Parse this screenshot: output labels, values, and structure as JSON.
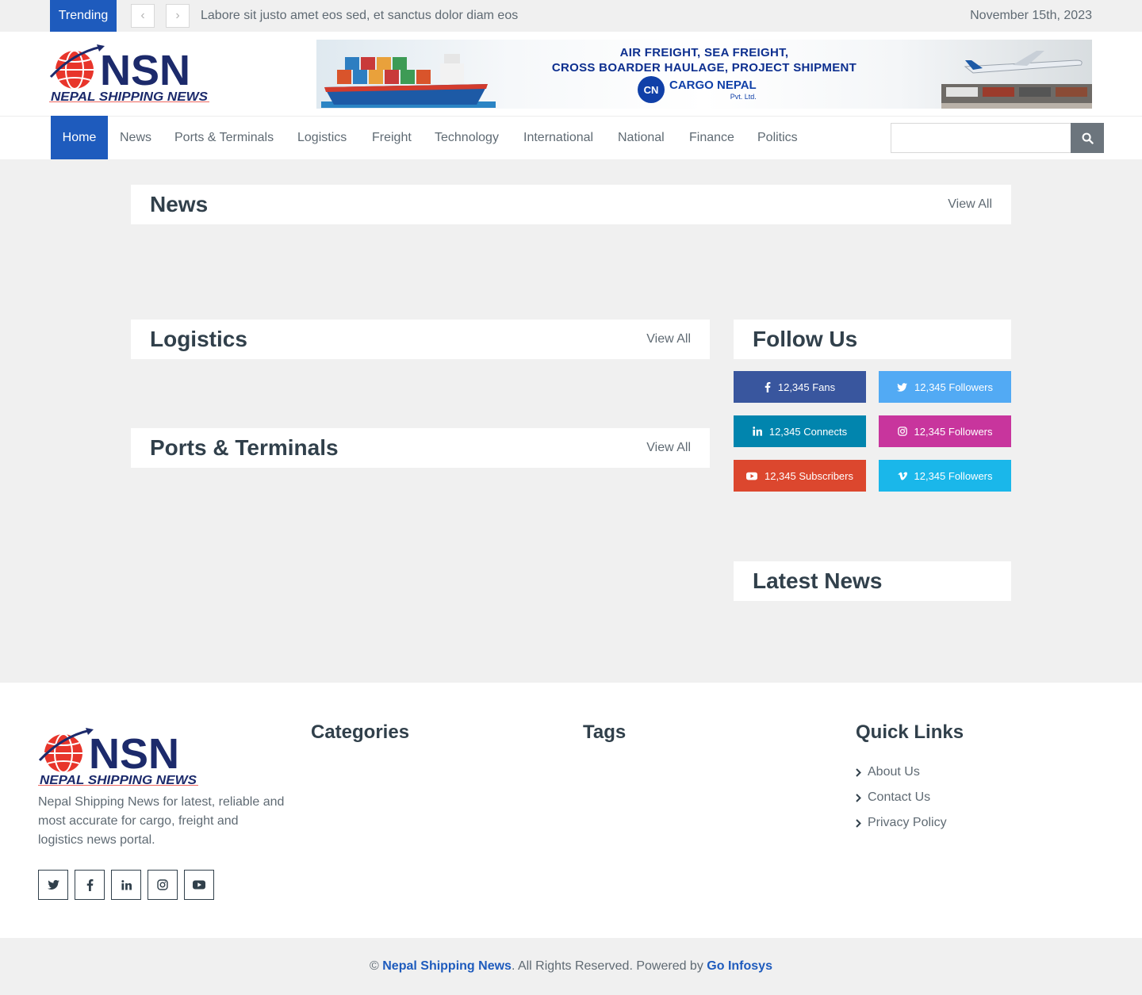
{
  "topbar": {
    "trending_label": "Trending",
    "headline": "Labore sit justo amet eos sed, et sanctus dolor diam eos",
    "date": "November 15th, 2023"
  },
  "logo": {
    "mark": "NSN",
    "subtitle": "NEPAL SHIPPING NEWS"
  },
  "banner": {
    "line1": "AIR FREIGHT,  SEA FREIGHT,",
    "line2": "CROSS BOARDER HAULAGE, PROJECT SHIPMENT",
    "brand_mark": "CN",
    "brand_name": "CARGO NEPAL",
    "brand_suffix": "Pvt. Ltd."
  },
  "nav": {
    "items": [
      "Home",
      "News",
      "Ports & Terminals",
      "Logistics",
      "Freight",
      "Technology",
      "International",
      "National",
      "Finance",
      "Politics"
    ],
    "active": "Home",
    "search_placeholder": ""
  },
  "sections": {
    "news": {
      "title": "News",
      "link": "View All"
    },
    "logistics": {
      "title": "Logistics",
      "link": "View All"
    },
    "ports": {
      "title": "Ports & Terminals",
      "link": "View All"
    },
    "follow": {
      "title": "Follow Us"
    },
    "latest": {
      "title": "Latest News"
    }
  },
  "social": [
    {
      "network": "facebook",
      "icon": "facebook-icon",
      "text": "12,345 Fans",
      "color": "#39569e"
    },
    {
      "network": "twitter",
      "icon": "twitter-icon",
      "text": "12,345 Followers",
      "color": "#52aaf4"
    },
    {
      "network": "linkedin",
      "icon": "linkedin-icon",
      "text": "12,345 Connects",
      "color": "#0185ae"
    },
    {
      "network": "instagram",
      "icon": "instagram-icon",
      "text": "12,345 Followers",
      "color": "#c8359d"
    },
    {
      "network": "youtube",
      "icon": "youtube-icon",
      "text": "12,345 Subscribers",
      "color": "#dc472e"
    },
    {
      "network": "vimeo",
      "icon": "vimeo-icon",
      "text": "12,345 Followers",
      "color": "#1ab7ea"
    }
  ],
  "footer": {
    "about": "Nepal Shipping News for latest, reliable and most accurate for cargo, freight and logistics news portal.",
    "categories_title": "Categories",
    "tags_title": "Tags",
    "quicklinks_title": "Quick Links",
    "quicklinks": [
      "About Us",
      "Contact Us",
      "Privacy Policy"
    ],
    "social_icons": [
      "twitter-icon",
      "facebook-icon",
      "linkedin-icon",
      "instagram-icon",
      "youtube-icon"
    ]
  },
  "copyright": {
    "prefix": "© ",
    "site": "Nepal Shipping News",
    "middle": ". All Rights Reserved. Powered by ",
    "powered": "Go Infosys"
  },
  "colors": {
    "primary": "#1e5bbd",
    "dark": "#31404b",
    "muted": "#5f6a73",
    "logo_red": "#e8352b",
    "logo_navy": "#1c2a6b"
  }
}
